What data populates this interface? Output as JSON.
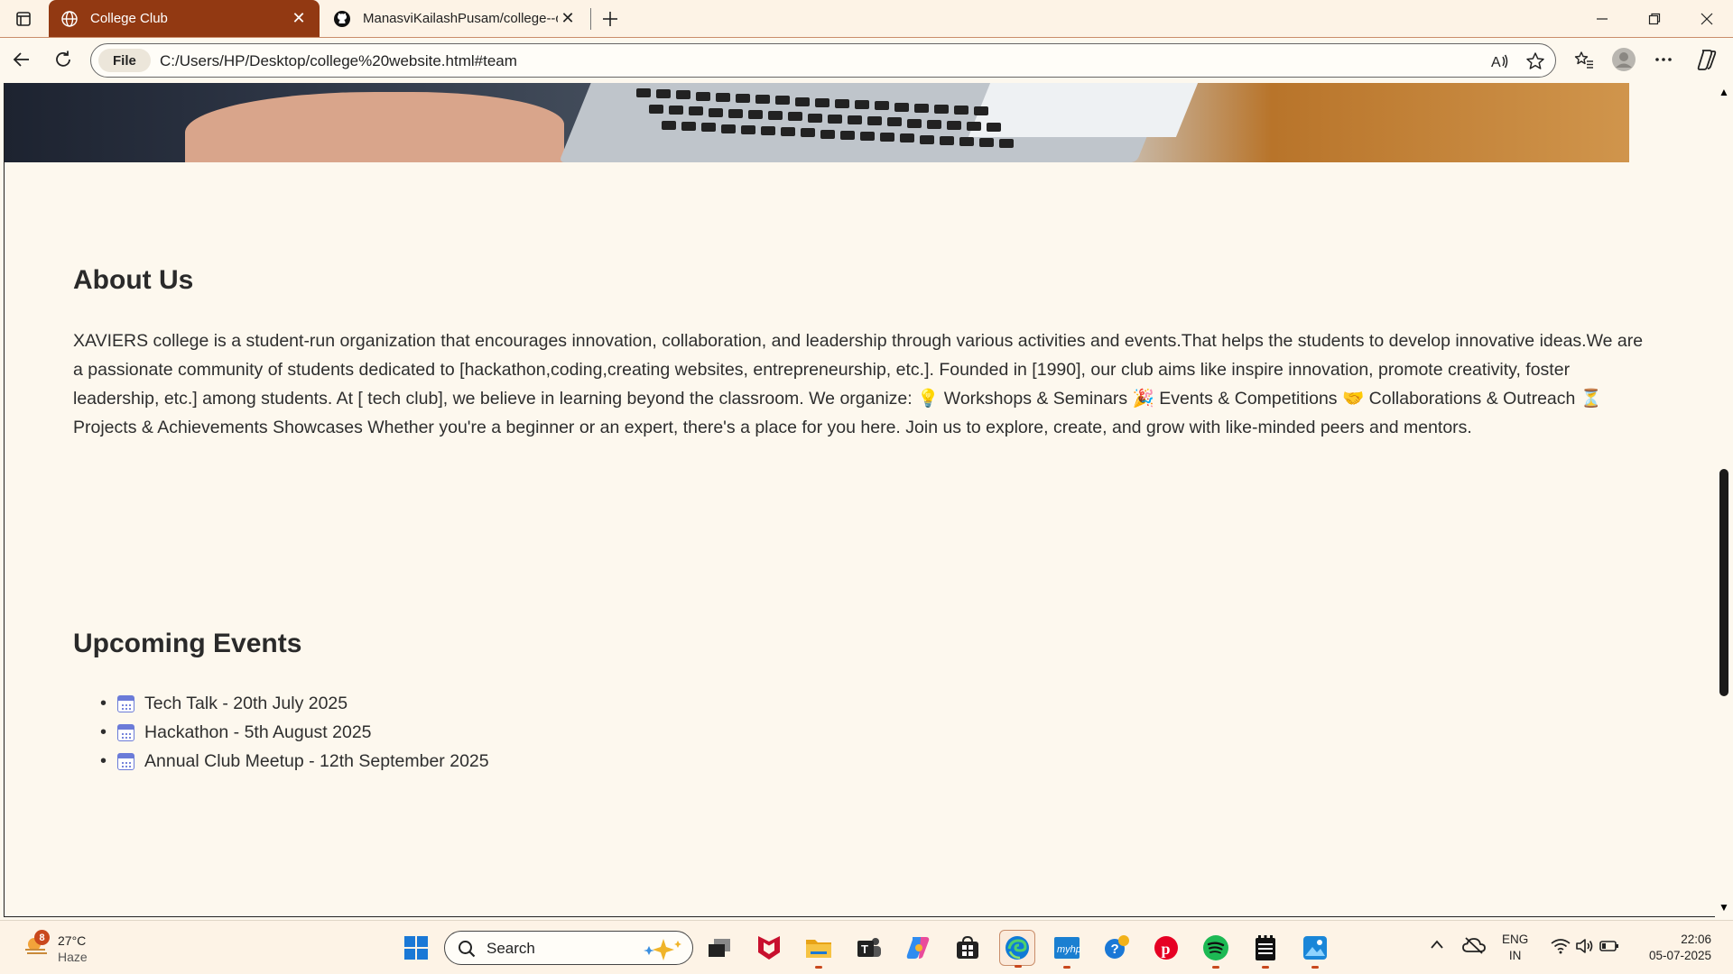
{
  "browser": {
    "tabs": [
      {
        "title": "College Club",
        "active": true
      },
      {
        "title": "ManasviKailashPusam/college--cl",
        "active": false
      }
    ],
    "address": {
      "scheme_chip": "File",
      "url": "C:/Users/HP/Desktop/college%20website.html#team"
    }
  },
  "page": {
    "about": {
      "heading": "About Us",
      "text": "XAVIERS college is a student-run organization that encourages innovation, collaboration, and leadership through various activities and events.That helps the students to develop innovative ideas.We are a passionate community of students dedicated to [hackathon,coding,creating websites, entrepreneurship, etc.]. Founded in [1990], our club aims like inspire innovation, promote creativity, foster leadership, etc.] among students. At [ tech club], we believe in learning beyond the classroom. We organize: 💡 Workshops & Seminars 🎉 Events & Competitions 🤝 Collaborations & Outreach ⏳ Projects & Achievements Showcases Whether you're a beginner or an expert, there's a place for you here. Join us to explore, create, and grow with like-minded peers and mentors."
    },
    "events": {
      "heading": "Upcoming Events",
      "items": [
        "Tech Talk - 20th July 2025",
        "Hackathon - 5th August 2025",
        "Annual Club Meetup - 12th September 2025"
      ]
    }
  },
  "taskbar": {
    "weather": {
      "badge": "8",
      "temp": "27°C",
      "condition": "Haze"
    },
    "search_label": "Search",
    "language": {
      "line1": "ENG",
      "line2": "IN"
    },
    "clock": {
      "time": "22:06",
      "date": "05-07-2025"
    },
    "pinned_icons": [
      "start-icon",
      "search-icon",
      "task-view-icon",
      "mcafee-icon",
      "file-explorer-icon",
      "teams-icon",
      "copilot-icon",
      "microsoft-store-icon",
      "edge-icon",
      "myhp-icon",
      "get-help-icon",
      "pinterest-icon",
      "spotify-icon",
      "notepad-icon",
      "photos-icon"
    ]
  },
  "colors": {
    "tab_active_bg": "#923912",
    "page_bg": "#fdf8ee",
    "chrome_bg": "#fdf3e6",
    "accent": "#c9481d"
  }
}
